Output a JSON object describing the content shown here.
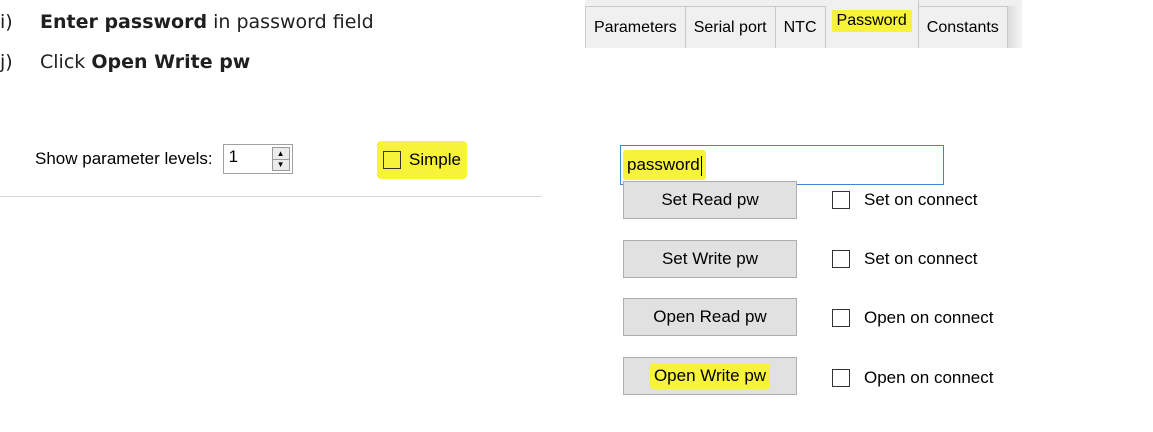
{
  "instructions": [
    {
      "marker": "i)",
      "bold": "Enter password",
      "rest": " in password field"
    },
    {
      "marker": "j)",
      "prefix": "Click ",
      "bold": "Open Write pw"
    }
  ],
  "parameters_panel": {
    "levels_label": "Show parameter levels:",
    "levels_value": "1",
    "simple_label": "Simple"
  },
  "tabs": [
    "Parameters",
    "Serial port",
    "NTC",
    "Password",
    "Constants"
  ],
  "active_tab": "Password",
  "password_panel": {
    "input_value": "password",
    "buttons": {
      "set_read": "Set Read pw",
      "set_write": "Set Write pw",
      "open_read": "Open Read pw",
      "open_write": "Open Write pw"
    },
    "options": [
      "Set on connect",
      "Set on connect",
      "Open on connect",
      "Open on connect"
    ]
  },
  "colors": {
    "highlight": "#f7f23a",
    "input_border": "#3f86d4"
  }
}
